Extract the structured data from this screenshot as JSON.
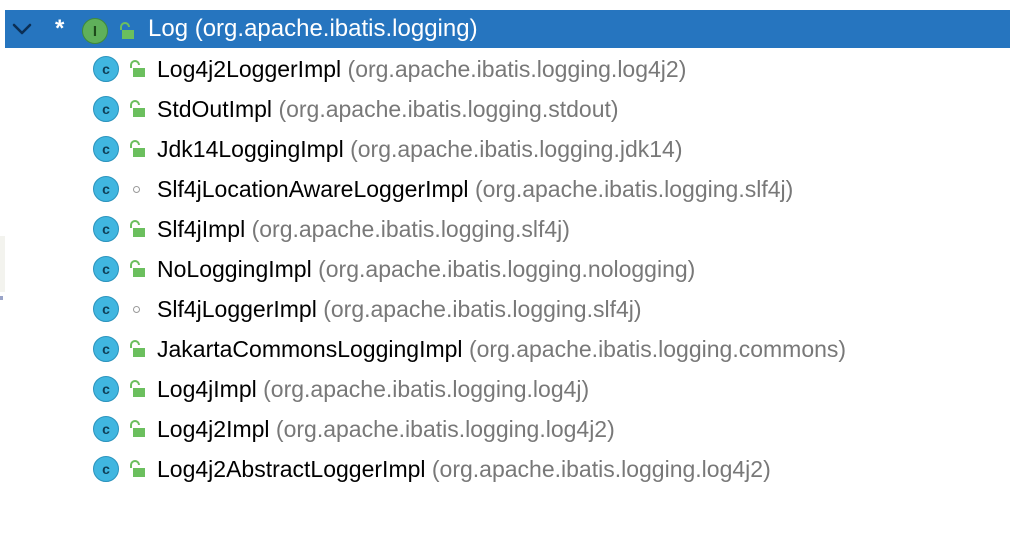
{
  "root": {
    "expanded_icon": "chevron-down-icon",
    "marker": "*",
    "kind_icon_letter": "I",
    "visibility_icon": "public-lock-icon",
    "name": "Log",
    "package": "(org.apache.ibatis.logging)"
  },
  "items": [
    {
      "icon_letter": "c",
      "visibility": "public",
      "name": "Log4j2LoggerImpl",
      "package": "(org.apache.ibatis.logging.log4j2)"
    },
    {
      "icon_letter": "c",
      "visibility": "public",
      "name": "StdOutImpl",
      "package": "(org.apache.ibatis.logging.stdout)"
    },
    {
      "icon_letter": "c",
      "visibility": "public",
      "name": "Jdk14LoggingImpl",
      "package": "(org.apache.ibatis.logging.jdk14)"
    },
    {
      "icon_letter": "c",
      "visibility": "package-private",
      "name": "Slf4jLocationAwareLoggerImpl",
      "package": "(org.apache.ibatis.logging.slf4j)"
    },
    {
      "icon_letter": "c",
      "visibility": "public",
      "name": "Slf4jImpl",
      "package": "(org.apache.ibatis.logging.slf4j)"
    },
    {
      "icon_letter": "c",
      "visibility": "public",
      "name": "NoLoggingImpl",
      "package": "(org.apache.ibatis.logging.nologging)"
    },
    {
      "icon_letter": "c",
      "visibility": "package-private",
      "name": "Slf4jLoggerImpl",
      "package": "(org.apache.ibatis.logging.slf4j)"
    },
    {
      "icon_letter": "c",
      "visibility": "public",
      "name": "JakartaCommonsLoggingImpl",
      "package": "(org.apache.ibatis.logging.commons)"
    },
    {
      "icon_letter": "c",
      "visibility": "public",
      "name": "Log4jImpl",
      "package": "(org.apache.ibatis.logging.log4j)"
    },
    {
      "icon_letter": "c",
      "visibility": "public",
      "name": "Log4j2Impl",
      "package": "(org.apache.ibatis.logging.log4j2)"
    },
    {
      "icon_letter": "c",
      "visibility": "public",
      "name": "Log4j2AbstractLoggerImpl",
      "package": "(org.apache.ibatis.logging.log4j2)"
    }
  ],
  "colors": {
    "selection": "#2675bf",
    "class_icon": "#40b6e0",
    "interface_icon": "#5fb05a",
    "package_text": "#787878"
  }
}
